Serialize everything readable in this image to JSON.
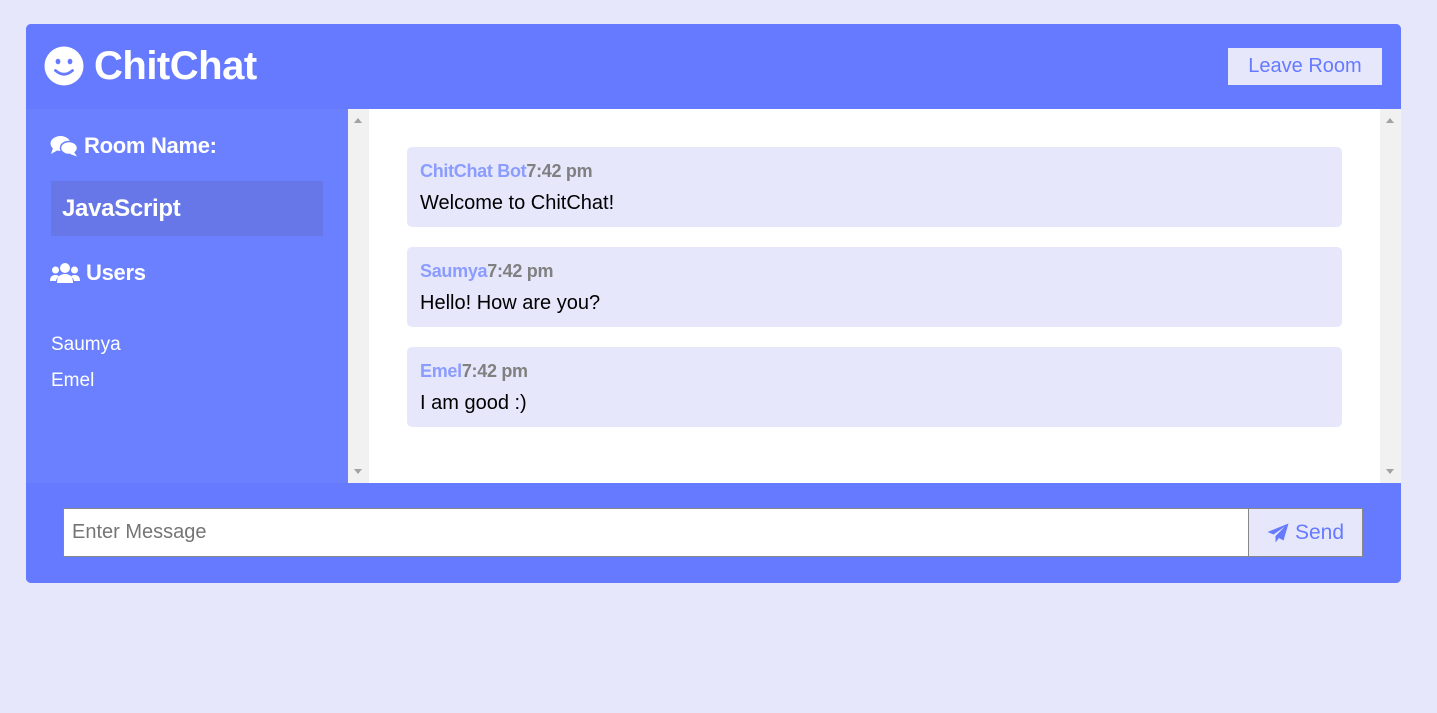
{
  "app": {
    "title": "ChitChat",
    "logo_icon": "smile-icon",
    "leave_label": "Leave Room",
    "colors": {
      "primary": "#667aff",
      "sidebar": "#6b80ff",
      "room_box": "#6777e7",
      "light": "#e6e7fb",
      "username": "#8b9cff",
      "time": "#808080"
    }
  },
  "sidebar": {
    "room_heading": "Room Name:",
    "room_icon": "comments-icon",
    "room_name": "JavaScript",
    "users_heading": "Users",
    "users_icon": "users-icon",
    "users": [
      "Saumya",
      "Emel"
    ]
  },
  "messages": [
    {
      "user": "ChitChat Bot",
      "time": "7:42 pm",
      "text": "Welcome to ChitChat!"
    },
    {
      "user": "Saumya",
      "time": "7:42 pm",
      "text": "Hello! How are you?"
    },
    {
      "user": "Emel",
      "time": "7:42 pm",
      "text": "I am good :)"
    }
  ],
  "composer": {
    "placeholder": "Enter Message",
    "value": "",
    "send_label": "Send",
    "send_icon": "paper-plane-icon"
  }
}
